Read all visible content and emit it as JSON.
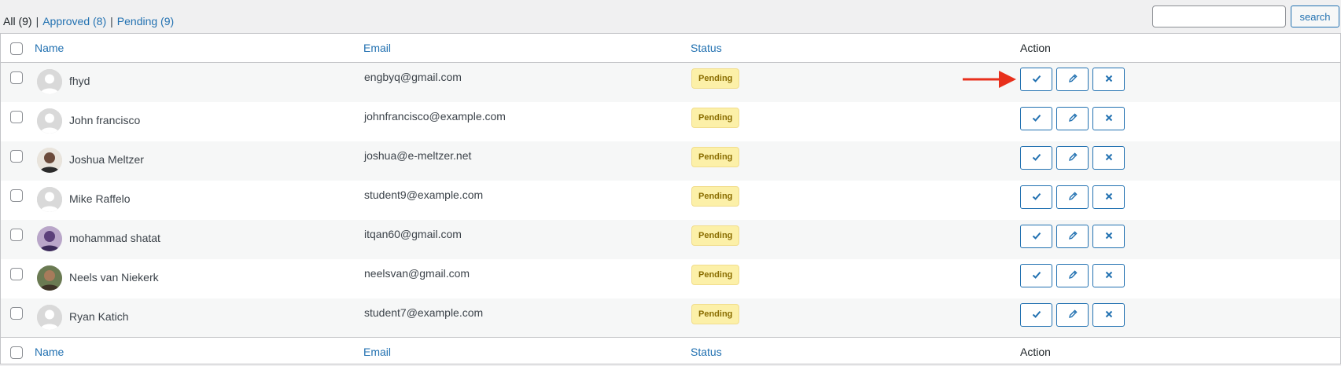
{
  "filters": {
    "all": "All (9)",
    "approved": "Approved (8)",
    "pending": "Pending (9)",
    "separator": "|"
  },
  "search": {
    "value": "",
    "button_label": "search"
  },
  "columns": {
    "name": "Name",
    "email": "Email",
    "status": "Status",
    "action": "Action"
  },
  "rows": [
    {
      "name": "fhyd",
      "email": "engbyq@gmail.com",
      "status": "Pending",
      "avatar": "default-avatar"
    },
    {
      "name": "John francisco",
      "email": "johnfrancisco@example.com",
      "status": "Pending",
      "avatar": "default-avatar"
    },
    {
      "name": "Joshua Meltzer",
      "email": "joshua@e-meltzer.net",
      "status": "Pending",
      "avatar": "photo-avatar"
    },
    {
      "name": "Mike Raffelo",
      "email": "student9@example.com",
      "status": "Pending",
      "avatar": "default-avatar"
    },
    {
      "name": "mohammad shatat",
      "email": "itqan60@gmail.com",
      "status": "Pending",
      "avatar": "photo-avatar"
    },
    {
      "name": "Neels van Niekerk",
      "email": "neelsvan@gmail.com",
      "status": "Pending",
      "avatar": "photo-avatar"
    },
    {
      "name": "Ryan Katich",
      "email": "student7@example.com",
      "status": "Pending",
      "avatar": "default-avatar"
    }
  ],
  "icons": {
    "approve": "checkmark-icon",
    "edit": "pencil-icon",
    "reject": "close-icon",
    "annotation": "red-arrow-icon"
  },
  "colors": {
    "link": "#2271b1",
    "badge_bg": "#fcf0a8",
    "badge_text": "#8a6d00",
    "annotation_arrow": "#e8301c"
  }
}
